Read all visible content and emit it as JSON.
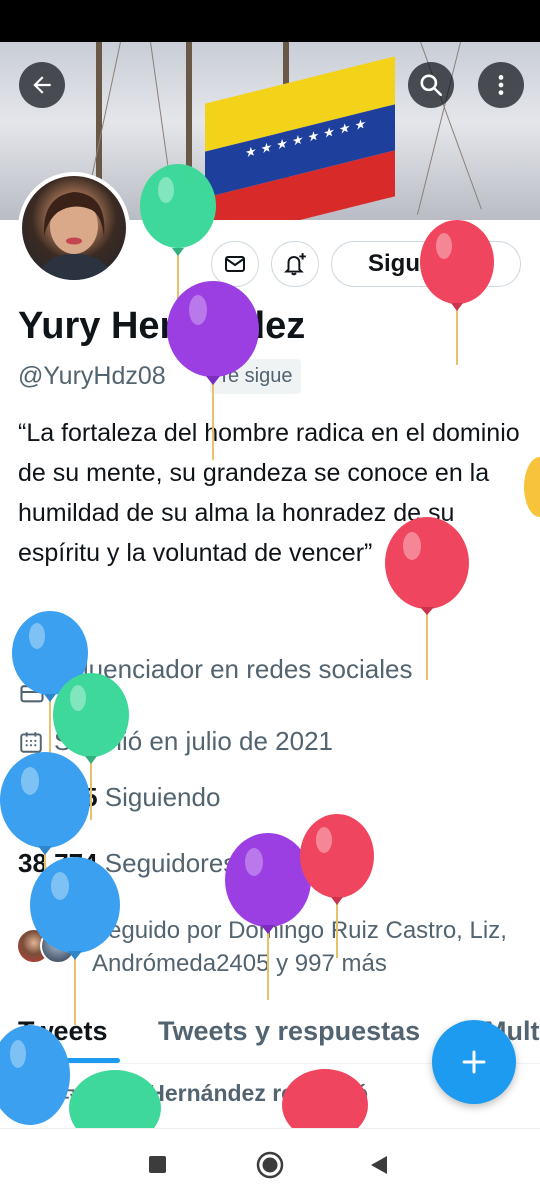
{
  "colors": {
    "accent": "#1d9bf0",
    "text_primary": "#0f1419",
    "text_secondary": "#536471",
    "flag_yellow": "#f3d31a",
    "flag_blue": "#1f3f9c",
    "flag_red": "#d92a2a"
  },
  "header": {
    "back_icon": "arrow-left-icon",
    "search_icon": "search-icon",
    "more_icon": "more-vertical-icon"
  },
  "profile": {
    "name": "Yury Hernández",
    "handle": "@YuryHdz08",
    "follows_you_badge": "Te sigue",
    "bio": "“La fortaleza del hombre radica en el dominio de su mente, su grandeza se conoce en la humildad de su alma la honradez de su espíritu y la voluntad de vencer”",
    "category": "Influenciador en redes sociales",
    "joined": "Se unió en julio de 2021",
    "following_count": "15,235",
    "following_label": "Siguiendo",
    "followers_count": "38,774",
    "followers_label": "Seguidores",
    "followed_by": "Seguido por Domingo Ruiz Castro, Liz, Andrómeda2405 y 997 más"
  },
  "actions": {
    "message_icon": "envelope-icon",
    "notify_icon": "bell-plus-icon",
    "follow_button": "Siguiendo"
  },
  "tabs": [
    {
      "label": "Tweets",
      "active": true
    },
    {
      "label": "Tweets y respuestas",
      "active": false
    },
    {
      "label": "Multimedia",
      "active": false
    }
  ],
  "timeline": {
    "retweet_text": "Yury Hernández retwitteó"
  },
  "fab": {
    "icon": "plus-icon"
  },
  "navbar": {
    "icons": [
      "square-stop-icon",
      "circle-home-icon",
      "triangle-back-icon"
    ]
  },
  "balloon_colors": {
    "green": "#3ed99a",
    "purple": "#9b3fe3",
    "red": "#f0455f",
    "blue": "#3aa0ef",
    "yellow": "#f6c33a"
  }
}
